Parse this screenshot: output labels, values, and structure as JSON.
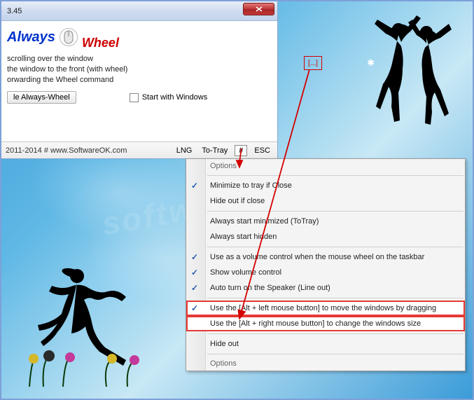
{
  "window": {
    "title_suffix": "3.45",
    "logo_always": "Always",
    "logo_wheel": "Wheel",
    "opt_scroll": "scrolling over the window",
    "opt_front": "the window to the front (with wheel)",
    "opt_forward": "orwarding the Wheel command",
    "btn_disable": "le Always-Wheel",
    "chk_start": "Start with Windows"
  },
  "statusbar": {
    "copyright": "2011-2014 # www.SoftwareOK.com",
    "lng": "LNG",
    "totray": "To-Tray",
    "hash": "#",
    "esc": "ESC"
  },
  "menu": {
    "options_top": "Options",
    "minimize_tray": "Minimize to tray if Close",
    "hide_close": "Hide out if close",
    "start_min": "Always start minimized (ToTray)",
    "start_hidden": "Always start hidden",
    "volume_taskbar": "Use as a volume control when the mouse wheel on the taskbar",
    "show_volume": "Show volume control",
    "auto_speaker": "Auto turn on the Speaker (Line out)",
    "alt_left": "Use the [Alt + left mouse button] to move the windows by dragging",
    "alt_right": "Use the [Alt +  right mouse button] to change the windows size",
    "hide_out": "Hide out",
    "options_bottom": "Options"
  },
  "redmark": "[...]",
  "watermark": "softwareok.com"
}
